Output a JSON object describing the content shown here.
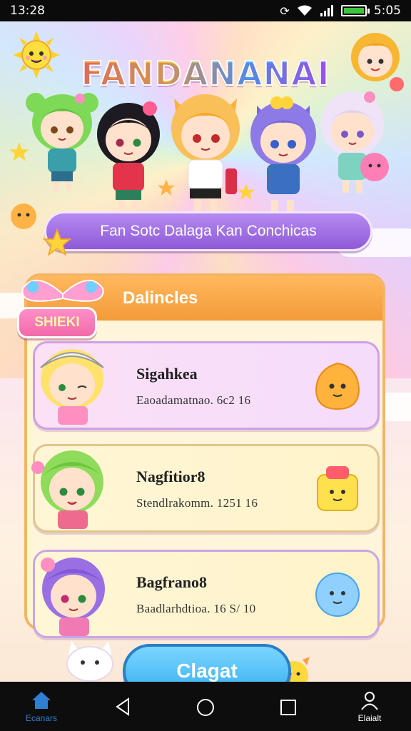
{
  "status_bar": {
    "time": "13:28",
    "clock_right": "5:05"
  },
  "app": {
    "logo": "FANDANANAI",
    "subtitle": "Fan Sotc Dalaga Kan Conchicas",
    "section_title": "Dalincles",
    "ribbon_label": "SHIEKI",
    "cards": [
      {
        "name": "Sigahkea",
        "detail": "Eaoadamatnao. 6c2 16",
        "mascot": "orange-blob-icon"
      },
      {
        "name": "Nagfitior8",
        "detail": "Stendlrakomm. 1251 16",
        "mascot": "yellow-bag-icon"
      },
      {
        "name": "Bagfrano8",
        "detail": "Baadlarhdtioa. 16 S/ 10",
        "mascot": "blue-blob-icon"
      }
    ],
    "action_button": "Clagat"
  },
  "nav": {
    "home_label": "Ecanars",
    "profile_label": "Elaialt"
  },
  "colors": {
    "accent_purple": "#8e5ad8",
    "accent_orange": "#f39b3a",
    "accent_blue": "#39aef0",
    "accent_pink": "#f26aa8"
  }
}
